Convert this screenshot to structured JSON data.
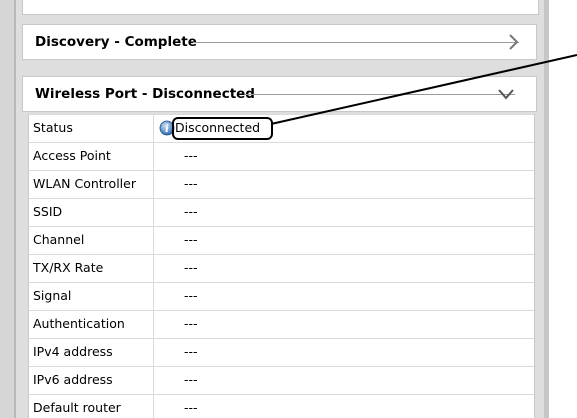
{
  "sections": {
    "discovery": {
      "title": "Discovery - Complete",
      "state": "collapsed"
    },
    "wireless": {
      "title": "Wireless Port - Disconnected",
      "state": "expanded"
    }
  },
  "table": {
    "rows": [
      {
        "label": "Status",
        "value": "Disconnected"
      },
      {
        "label": "Access Point",
        "value": "---"
      },
      {
        "label": "WLAN Controller",
        "value": "---"
      },
      {
        "label": "SSID",
        "value": "---"
      },
      {
        "label": "Channel",
        "value": "---"
      },
      {
        "label": "TX/RX Rate",
        "value": "---"
      },
      {
        "label": "Signal",
        "value": "---"
      },
      {
        "label": "Authentication",
        "value": "---"
      },
      {
        "label": "IPv4 address",
        "value": "---"
      },
      {
        "label": "IPv6 address",
        "value": "---"
      },
      {
        "label": "Default router",
        "value": "---"
      }
    ]
  },
  "icons": {
    "status": "info-icon",
    "discovery_toggle": "chevron-right-icon",
    "wireless_toggle": "chevron-down-icon"
  },
  "colors": {
    "panel_background": "#dedede",
    "info_icon": "#2f6fb3",
    "callout": "#000000"
  }
}
